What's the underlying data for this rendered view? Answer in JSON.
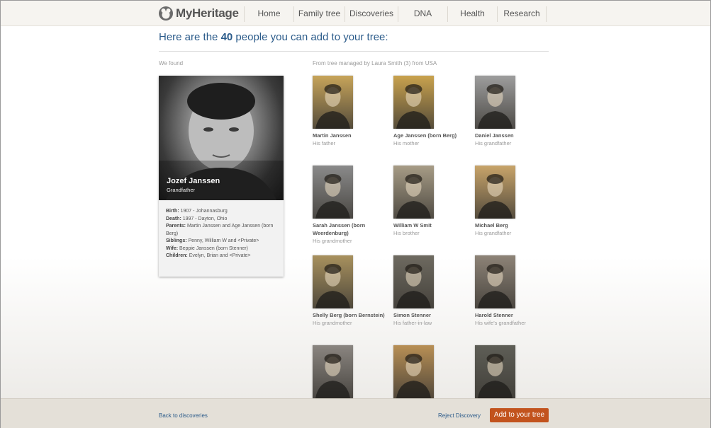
{
  "header": {
    "logo": "MyHeritage",
    "nav": [
      "Home",
      "Family tree",
      "Discoveries",
      "DNA",
      "Health",
      "Research"
    ]
  },
  "headline": {
    "prefix": "Here are the",
    "count": "40",
    "suffix": "people you can add to your tree:"
  },
  "we_found_label": "We found",
  "from_tree_label": "From tree managed by Laura Smith (3) from USA",
  "main_person": {
    "name": "Jozef Janssen",
    "relation": "Grandfather",
    "details": [
      {
        "key": "Birth:",
        "value": "1907 - Johannasburg"
      },
      {
        "key": "Death:",
        "value": "1997 - Dayton, Ohio"
      },
      {
        "key": "Parents:",
        "value": "Martin Janssen and Age Janssen (born Berg)"
      },
      {
        "key": "Siblings:",
        "value": "Penny, William W and <Private>"
      },
      {
        "key": "Wife:",
        "value": "Beppie Janssen (born Stenner)"
      },
      {
        "key": "Children:",
        "value": "Evelyn, Brian and <Private>"
      }
    ]
  },
  "people": [
    {
      "name": "Martin Janssen",
      "relation": "His father",
      "tone": "#c7a45a"
    },
    {
      "name": "Age Janssen (born Berg)",
      "relation": "His mother",
      "tone": "#c9a24e"
    },
    {
      "name": "Daniel Janssen",
      "relation": "His grandfather",
      "tone": "#9d9d9d"
    },
    {
      "name": "Sarah Janssen (born Weerdenburg)",
      "relation": "His grandmother",
      "tone": "#8a8a8a"
    },
    {
      "name": "William W Smit",
      "relation": "His brother",
      "tone": "#a79c86"
    },
    {
      "name": "Michael Berg",
      "relation": "His grandfather",
      "tone": "#c8a46a"
    },
    {
      "name": "Shelly Berg (born Bernstein)",
      "relation": "His grandmother",
      "tone": "#a8915e"
    },
    {
      "name": "Simon Stenner",
      "relation": "His father-in-law",
      "tone": "#6e6a60"
    },
    {
      "name": "Harold Stenner",
      "relation": "His wife's grandfather",
      "tone": "#8d8377"
    },
    {
      "name": "",
      "relation": "",
      "tone": "#8a8580"
    },
    {
      "name": "",
      "relation": "",
      "tone": "#b88f55"
    },
    {
      "name": "",
      "relation": "",
      "tone": "#5e5e56"
    }
  ],
  "footer": {
    "back": "Back to discoveries",
    "reject": "Reject Discovery",
    "add": "Add to your tree"
  }
}
